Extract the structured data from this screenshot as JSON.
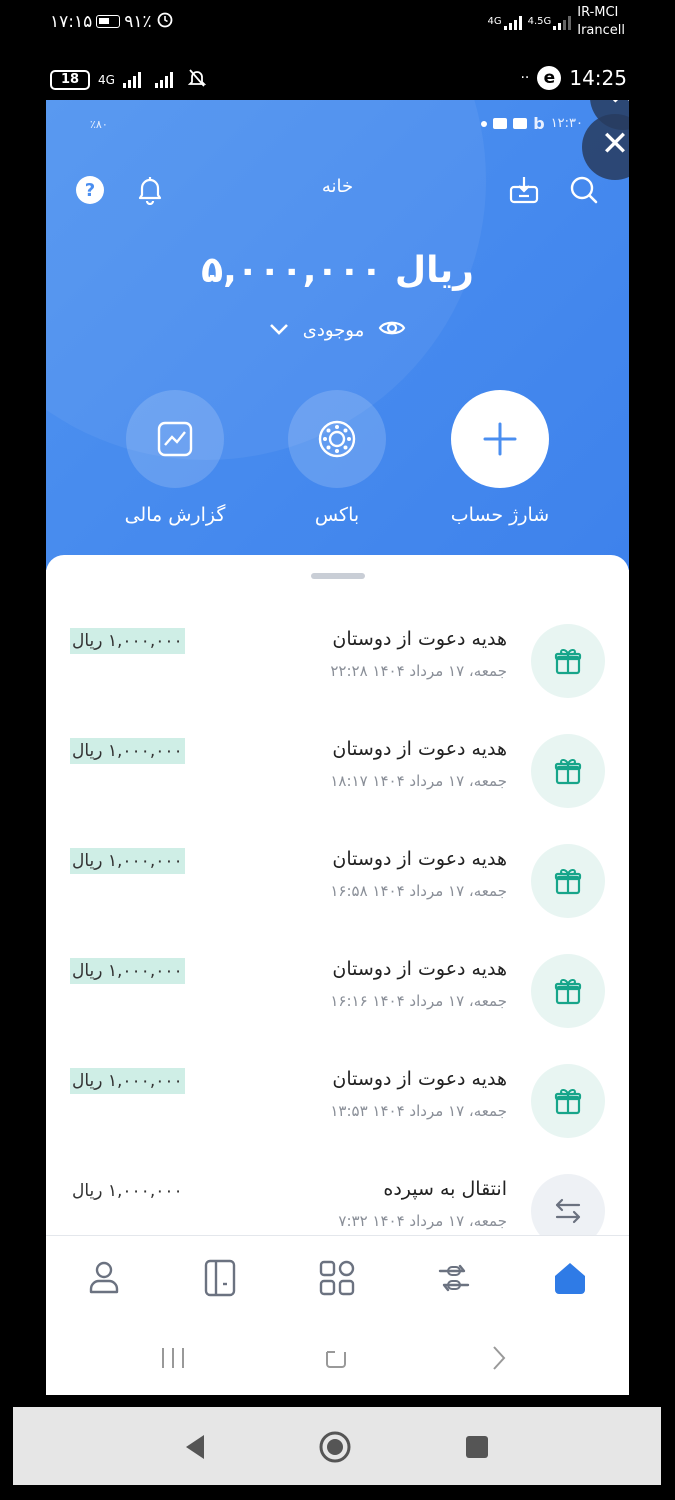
{
  "outer_status": {
    "time": "۱۷:۱۵",
    "battery": "۹۱٪",
    "net1": "4G",
    "net2": "4.5G",
    "carrier1": "IR-MCI",
    "carrier2": "Irancell"
  },
  "secondary_status": {
    "battery": "18",
    "net": "4G",
    "time": "14:25",
    "dots": "··"
  },
  "inner_status": {
    "left": "٪۸۰",
    "time": "۱۲:۳۰"
  },
  "header": {
    "title": "خانه"
  },
  "balance": {
    "amount": "۵,۰۰۰,۰۰۰ ریال",
    "label": "موجودی"
  },
  "actions": [
    {
      "label": "شارژ حساب",
      "icon": "plus-icon"
    },
    {
      "label": "باکس",
      "icon": "box-icon"
    },
    {
      "label": "گزارش مالی",
      "icon": "chart-icon"
    }
  ],
  "transactions": [
    {
      "title": "هدیه دعوت از دوستان",
      "date": "جمعه، ۱۷ مرداد ۱۴۰۴ ۲۲:۲۸",
      "amount": "۱,۰۰۰,۰۰۰ ریال",
      "icon": "gift-icon"
    },
    {
      "title": "هدیه دعوت از دوستان",
      "date": "جمعه، ۱۷ مرداد ۱۴۰۴ ۱۸:۱۷",
      "amount": "۱,۰۰۰,۰۰۰ ریال",
      "icon": "gift-icon"
    },
    {
      "title": "هدیه دعوت از دوستان",
      "date": "جمعه، ۱۷ مرداد ۱۴۰۴ ۱۶:۵۸",
      "amount": "۱,۰۰۰,۰۰۰ ریال",
      "icon": "gift-icon"
    },
    {
      "title": "هدیه دعوت از دوستان",
      "date": "جمعه، ۱۷ مرداد ۱۴۰۴ ۱۶:۱۶",
      "amount": "۱,۰۰۰,۰۰۰ ریال",
      "icon": "gift-icon"
    },
    {
      "title": "هدیه دعوت از دوستان",
      "date": "جمعه، ۱۷ مرداد ۱۴۰۴ ۱۳:۵۳",
      "amount": "۱,۰۰۰,۰۰۰ ریال",
      "icon": "gift-icon"
    },
    {
      "title": "انتقال به سپرده",
      "date": "جمعه، ۱۷ مرداد ۱۴۰۴ ۷:۳۲",
      "amount": "۱,۰۰۰,۰۰۰ ریال",
      "icon": "transfer-icon"
    }
  ],
  "bottom_nav": [
    "home-icon",
    "transfer-icon",
    "services-grid-icon",
    "cards-icon",
    "profile-icon"
  ],
  "colors": {
    "primary_blue": "#4a8ef0",
    "highlight_green": "#cfeee6",
    "icon_green": "#17a58a"
  }
}
